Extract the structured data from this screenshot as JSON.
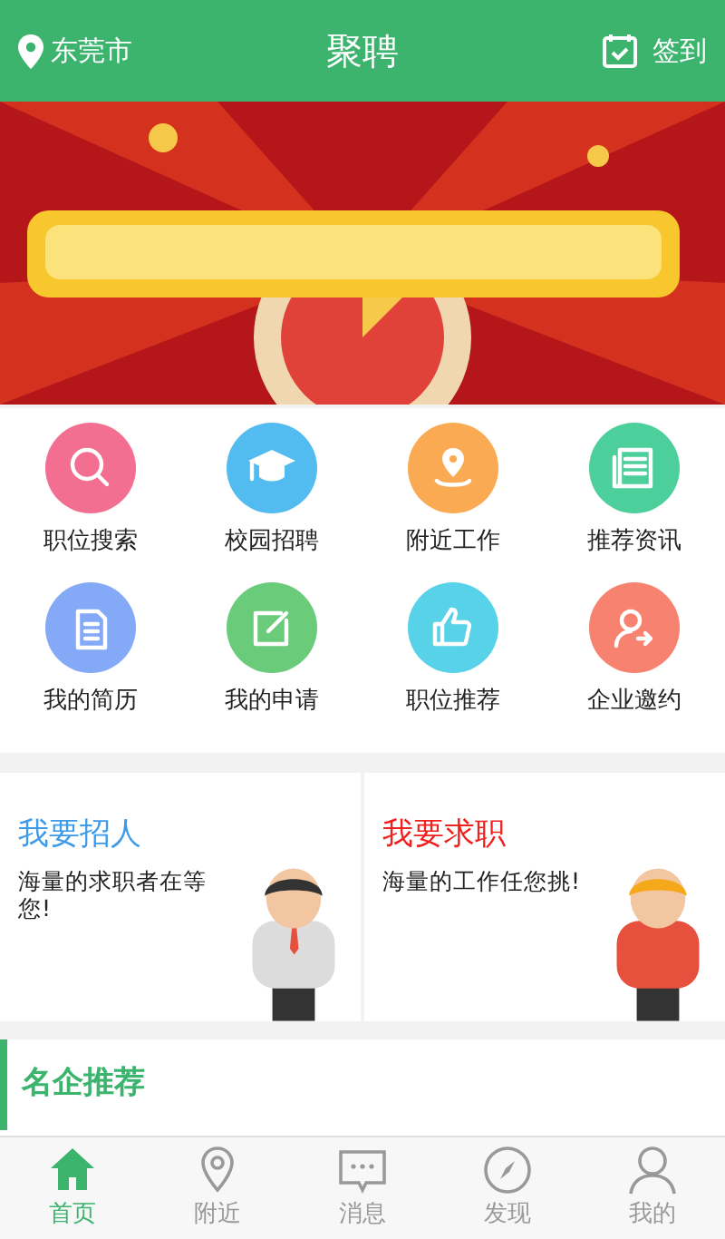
{
  "header": {
    "location": "东莞市",
    "title": "聚聘",
    "action": "签到"
  },
  "shortcuts": [
    {
      "label": "职位搜索",
      "color": "#f36f92"
    },
    {
      "label": "校园招聘",
      "color": "#52bbef"
    },
    {
      "label": "附近工作",
      "color": "#f9aa52"
    },
    {
      "label": "推荐资讯",
      "color": "#4dcf9c"
    },
    {
      "label": "我的简历",
      "color": "#84aaf7"
    },
    {
      "label": "我的申请",
      "color": "#6acb7a"
    },
    {
      "label": "职位推荐",
      "color": "#57d2e8"
    },
    {
      "label": "企业邀约",
      "color": "#f6826f"
    }
  ],
  "cards": [
    {
      "title": "我要招人",
      "text": "海量的求职者在等您!",
      "color": "#3d9be9"
    },
    {
      "title": "我要求职",
      "text": "海量的工作任您挑!",
      "color": "#f0201f"
    }
  ],
  "section": {
    "title": "名企推荐"
  },
  "tabs": [
    {
      "label": "首页",
      "selected": true
    },
    {
      "label": "附近",
      "selected": false
    },
    {
      "label": "消息",
      "selected": false
    },
    {
      "label": "发现",
      "selected": false
    },
    {
      "label": "我的",
      "selected": false
    }
  ]
}
